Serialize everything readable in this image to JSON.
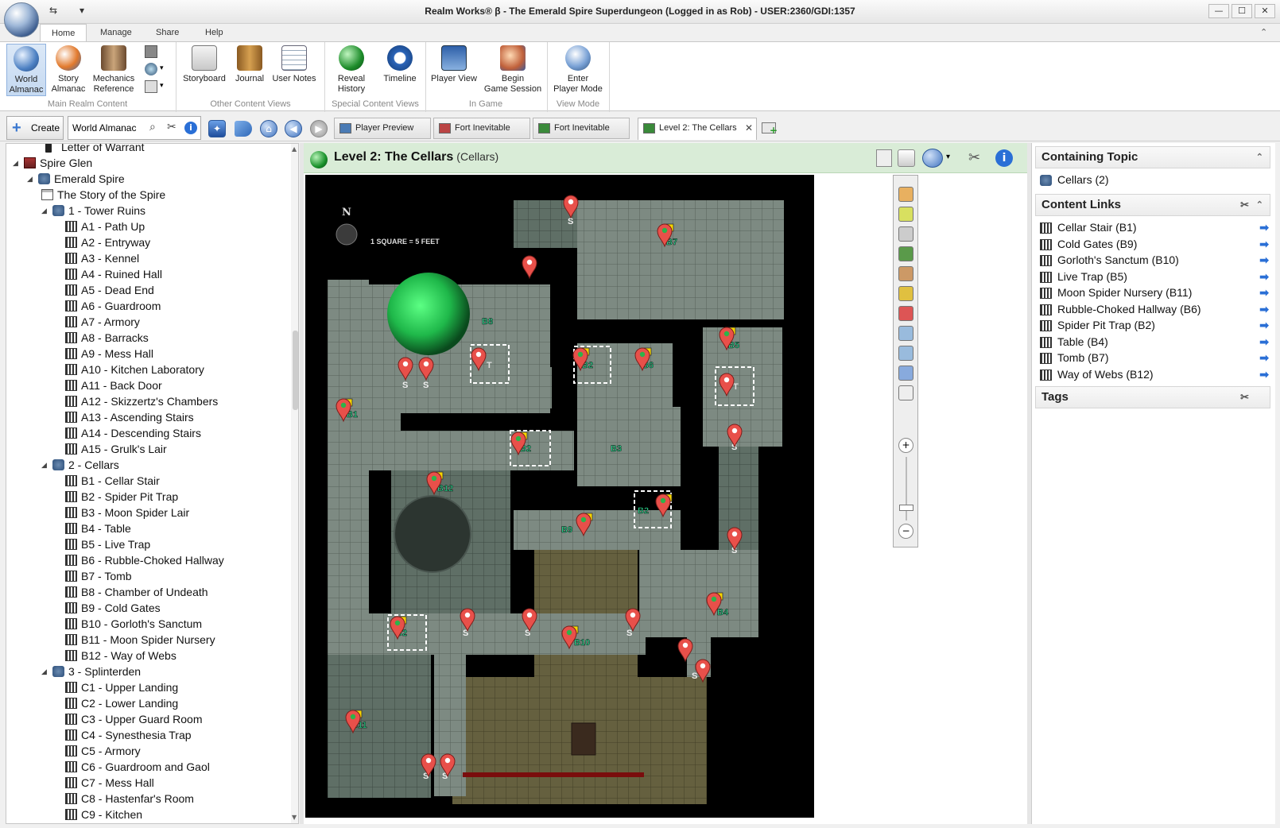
{
  "window": {
    "title": "Realm Works® β - The Emerald Spire Superdungeon (Logged in as Rob) - USER:2360/GDI:1357",
    "controls": [
      "—",
      "☐",
      "✕"
    ]
  },
  "ribbon_tabs": [
    "Home",
    "Manage",
    "Share",
    "Help"
  ],
  "ribbon_groups": [
    {
      "label": "Main Realm Content",
      "buttons": [
        "World\nAlmanac",
        "Story\nAlmanac",
        "Mechanics\nReference"
      ]
    },
    {
      "label": "Other Content Views",
      "buttons": [
        "Storyboard",
        "Journal",
        "User Notes"
      ]
    },
    {
      "label": "Special Content Views",
      "buttons": [
        "Reveal\nHistory",
        "Timeline"
      ]
    },
    {
      "label": "In Game",
      "buttons": [
        "Player View",
        "Begin\nGame Session"
      ]
    },
    {
      "label": "View Mode",
      "buttons": [
        "Enter\nPlayer Mode"
      ]
    }
  ],
  "toolbar": {
    "create_label": "Create",
    "search_value": "World Almanac"
  },
  "doc_tabs": [
    {
      "label": "Player Preview",
      "active": false
    },
    {
      "label": "Fort Inevitable",
      "active": false
    },
    {
      "label": "Fort Inevitable",
      "active": false
    },
    {
      "label": "Level 2: The Cellars",
      "active": true
    }
  ],
  "tree": [
    {
      "label": "Letter of Warrant",
      "indent": 3,
      "icon": "pawn",
      "exp": ""
    },
    {
      "label": "Spire Glen",
      "indent": 1,
      "icon": "castle",
      "exp": "◢"
    },
    {
      "label": "Emerald Spire",
      "indent": 2,
      "icon": "region",
      "exp": "◢"
    },
    {
      "label": "The Story of the Spire",
      "indent": 3,
      "icon": "doc",
      "exp": ""
    },
    {
      "label": "1 - Tower Ruins",
      "indent": 3,
      "icon": "region",
      "exp": "◢"
    },
    {
      "label": "A1 - Path Up",
      "indent": 4,
      "icon": "scene",
      "exp": ""
    },
    {
      "label": "A2 - Entryway",
      "indent": 4,
      "icon": "scene",
      "exp": ""
    },
    {
      "label": "A3 - Kennel",
      "indent": 4,
      "icon": "scene",
      "exp": ""
    },
    {
      "label": "A4 - Ruined Hall",
      "indent": 4,
      "icon": "scene",
      "exp": ""
    },
    {
      "label": "A5 - Dead End",
      "indent": 4,
      "icon": "scene",
      "exp": ""
    },
    {
      "label": "A6 - Guardroom",
      "indent": 4,
      "icon": "scene",
      "exp": ""
    },
    {
      "label": "A7 - Armory",
      "indent": 4,
      "icon": "scene",
      "exp": ""
    },
    {
      "label": "A8 - Barracks",
      "indent": 4,
      "icon": "scene",
      "exp": ""
    },
    {
      "label": "A9 - Mess Hall",
      "indent": 4,
      "icon": "scene",
      "exp": ""
    },
    {
      "label": "A10 - Kitchen Laboratory",
      "indent": 4,
      "icon": "scene",
      "exp": ""
    },
    {
      "label": "A11 - Back Door",
      "indent": 4,
      "icon": "scene",
      "exp": ""
    },
    {
      "label": "A12 - Skizzertz's Chambers",
      "indent": 4,
      "icon": "scene",
      "exp": ""
    },
    {
      "label": "A13 - Ascending Stairs",
      "indent": 4,
      "icon": "scene",
      "exp": ""
    },
    {
      "label": "A14 - Descending Stairs",
      "indent": 4,
      "icon": "scene",
      "exp": ""
    },
    {
      "label": "A15 - Grulk's Lair",
      "indent": 4,
      "icon": "scene",
      "exp": ""
    },
    {
      "label": "2 - Cellars",
      "indent": 3,
      "icon": "region",
      "exp": "◢"
    },
    {
      "label": "B1 - Cellar Stair",
      "indent": 4,
      "icon": "scene",
      "exp": ""
    },
    {
      "label": "B2 - Spider Pit Trap",
      "indent": 4,
      "icon": "scene",
      "exp": ""
    },
    {
      "label": "B3 - Moon Spider Lair",
      "indent": 4,
      "icon": "scene",
      "exp": ""
    },
    {
      "label": "B4 - Table",
      "indent": 4,
      "icon": "scene",
      "exp": ""
    },
    {
      "label": "B5 - Live Trap",
      "indent": 4,
      "icon": "scene",
      "exp": ""
    },
    {
      "label": "B6 - Rubble-Choked Hallway",
      "indent": 4,
      "icon": "scene",
      "exp": ""
    },
    {
      "label": "B7 - Tomb",
      "indent": 4,
      "icon": "scene",
      "exp": ""
    },
    {
      "label": "B8 - Chamber of Undeath",
      "indent": 4,
      "icon": "scene",
      "exp": ""
    },
    {
      "label": "B9 - Cold Gates",
      "indent": 4,
      "icon": "scene",
      "exp": ""
    },
    {
      "label": "B10 - Gorloth's Sanctum",
      "indent": 4,
      "icon": "scene",
      "exp": ""
    },
    {
      "label": "B11 - Moon Spider Nursery",
      "indent": 4,
      "icon": "scene",
      "exp": ""
    },
    {
      "label": "B12 - Way of Webs",
      "indent": 4,
      "icon": "scene",
      "exp": ""
    },
    {
      "label": "3 - Splinterden",
      "indent": 3,
      "icon": "region",
      "exp": "◢"
    },
    {
      "label": "C1 - Upper Landing",
      "indent": 4,
      "icon": "scene",
      "exp": ""
    },
    {
      "label": "C2 - Lower Landing",
      "indent": 4,
      "icon": "scene",
      "exp": ""
    },
    {
      "label": "C3 - Upper Guard Room",
      "indent": 4,
      "icon": "scene",
      "exp": ""
    },
    {
      "label": "C4 - Synesthesia Trap",
      "indent": 4,
      "icon": "scene",
      "exp": ""
    },
    {
      "label": "C5 - Armory",
      "indent": 4,
      "icon": "scene",
      "exp": ""
    },
    {
      "label": "C6 - Guardroom and Gaol",
      "indent": 4,
      "icon": "scene",
      "exp": ""
    },
    {
      "label": "C7 - Mess Hall",
      "indent": 4,
      "icon": "scene",
      "exp": ""
    },
    {
      "label": "C8 - Hastenfar's Room",
      "indent": 4,
      "icon": "scene",
      "exp": ""
    },
    {
      "label": "C9 - Kitchen",
      "indent": 4,
      "icon": "scene",
      "exp": ""
    }
  ],
  "center": {
    "title": "Level 2: The Cellars",
    "subtitle": "(Cellars)"
  },
  "map": {
    "compass": "N",
    "scale_label": "1 SQUARE = 5 FEET",
    "room_labels": [
      "B1",
      "B2",
      "B2",
      "B2",
      "B2",
      "B3",
      "B4",
      "B5",
      "B6",
      "B7",
      "B8",
      "B9",
      "B10",
      "B11",
      "B12"
    ],
    "secret_marker": "S",
    "trap_marker": "T"
  },
  "right_panel": {
    "containing_header": "Containing Topic",
    "containing_item": "Cellars (2)",
    "links_header": "Content Links",
    "links": [
      "Cellar Stair (B1)",
      "Cold Gates (B9)",
      "Gorloth's Sanctum (B10)",
      "Live Trap (B5)",
      "Moon Spider Nursery (B11)",
      "Rubble-Choked Hallway (B6)",
      "Spider Pit Trap (B2)",
      "Table (B4)",
      "Tomb (B7)",
      "Way of Webs (B12)"
    ],
    "tags_header": "Tags"
  }
}
